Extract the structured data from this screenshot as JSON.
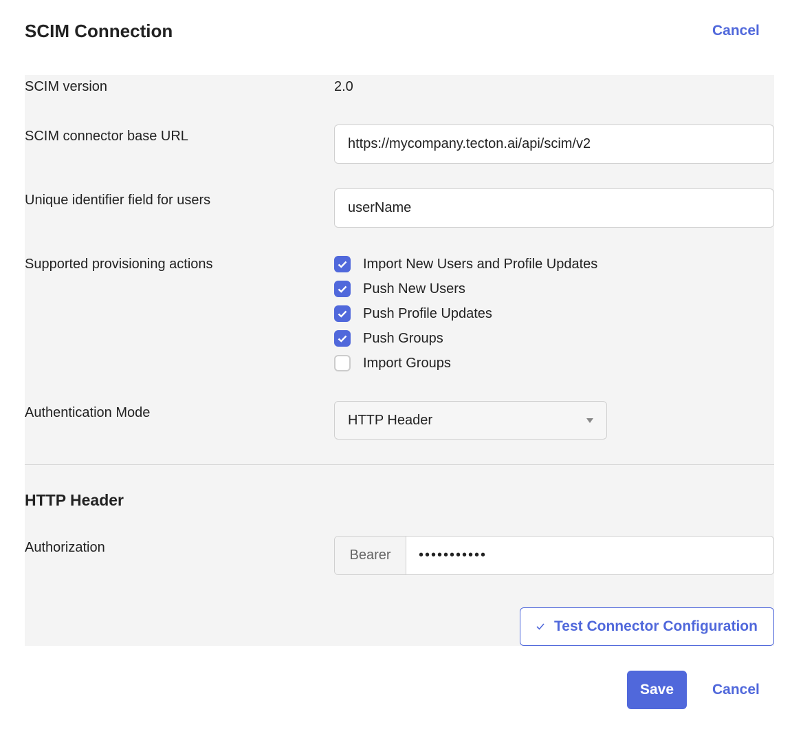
{
  "header": {
    "title": "SCIM Connection",
    "cancel_label": "Cancel"
  },
  "form": {
    "scim_version": {
      "label": "SCIM version",
      "value": "2.0"
    },
    "base_url": {
      "label": "SCIM connector base URL",
      "value": "https://mycompany.tecton.ai/api/scim/v2"
    },
    "unique_id": {
      "label": "Unique identifier field for users",
      "value": "userName"
    },
    "provisioning": {
      "label": "Supported provisioning actions",
      "options": [
        {
          "label": "Import New Users and Profile Updates",
          "checked": true
        },
        {
          "label": "Push New Users",
          "checked": true
        },
        {
          "label": "Push Profile Updates",
          "checked": true
        },
        {
          "label": "Push Groups",
          "checked": true
        },
        {
          "label": "Import Groups",
          "checked": false
        }
      ]
    },
    "auth_mode": {
      "label": "Authentication Mode",
      "value": "HTTP Header"
    }
  },
  "http_header": {
    "title": "HTTP Header",
    "authorization": {
      "label": "Authorization",
      "prefix": "Bearer",
      "value": "•••••••••••"
    }
  },
  "actions": {
    "test_label": "Test Connector Configuration",
    "save_label": "Save",
    "cancel_label": "Cancel"
  },
  "colors": {
    "accent": "#5068db",
    "panel": "#f4f4f4"
  }
}
